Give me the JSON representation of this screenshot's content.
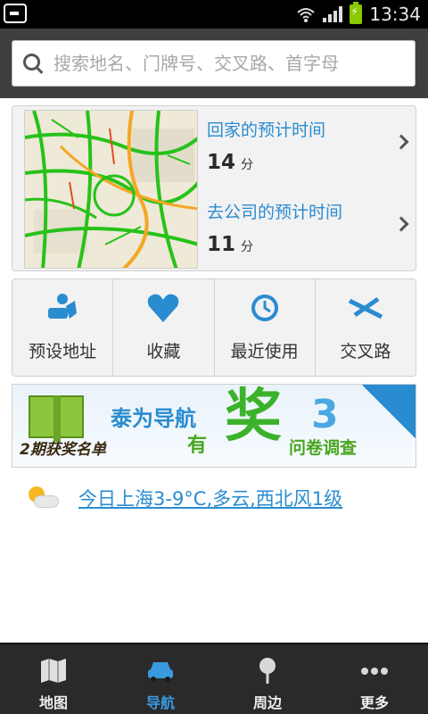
{
  "status_bar": {
    "time": "13:34"
  },
  "search": {
    "placeholder": "搜索地名、门牌号、交叉路、首字母"
  },
  "commute": {
    "home_label": "回家的预计时间",
    "home_value": "14",
    "home_unit": "分",
    "work_label": "去公司的预计时间",
    "work_value": "11",
    "work_unit": "分"
  },
  "actions": [
    {
      "label": "预设地址",
      "icon": "preset-address-icon"
    },
    {
      "label": "收藏",
      "icon": "heart-icon"
    },
    {
      "label": "最近使用",
      "icon": "clock-icon"
    },
    {
      "label": "交叉路",
      "icon": "crossroad-icon"
    }
  ],
  "banner": {
    "title": "泰为导航",
    "you": "有",
    "big": "奖",
    "number": "3",
    "survey": "问卷调查",
    "list": "2期获奖名单"
  },
  "weather": {
    "text": "今日上海3-9°C,多云,西北风1级"
  },
  "tabs": [
    {
      "label": "地图",
      "icon": "map-icon",
      "active": false
    },
    {
      "label": "导航",
      "icon": "car-icon",
      "active": true
    },
    {
      "label": "周边",
      "icon": "pin-icon",
      "active": false
    },
    {
      "label": "更多",
      "icon": "more-icon",
      "active": false
    }
  ],
  "colors": {
    "accent": "#2a8cd0",
    "traffic_green": "#27c21a",
    "traffic_orange": "#f5a623"
  }
}
